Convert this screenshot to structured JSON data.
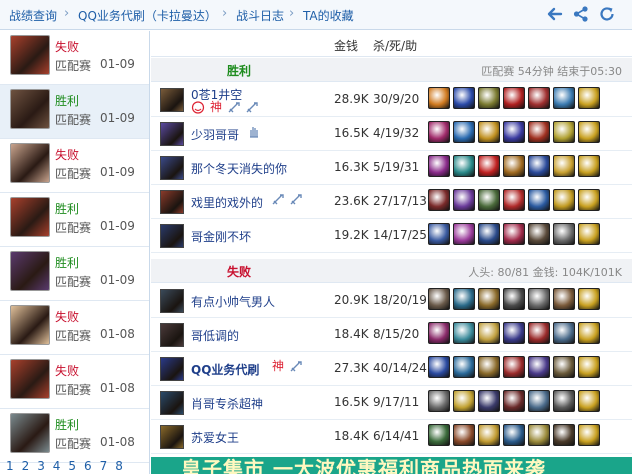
{
  "breadcrumbs": [
    {
      "label": "战绩查询",
      "icon": ""
    },
    {
      "label": "QQ业务代刷（卡拉曼达）",
      "icon": ""
    },
    {
      "label": "战斗日志",
      "icon": ""
    },
    {
      "label": "TA的收藏",
      "icon": ""
    }
  ],
  "toolbar": {
    "back_icon": "back-arrow-icon",
    "share_icon": "share-icon",
    "refresh_icon": "refresh-icon"
  },
  "sidebar": {
    "items": [
      {
        "result": "失败",
        "mode": "匹配赛",
        "date": "01-09",
        "win": false,
        "avatar_color": "#a8402c",
        "active": false
      },
      {
        "result": "胜利",
        "mode": "匹配赛",
        "date": "01-09",
        "win": true,
        "avatar_color": "#6e5240",
        "active": true
      },
      {
        "result": "失败",
        "mode": "匹配赛",
        "date": "01-09",
        "win": false,
        "avatar_color": "#c9a48e",
        "active": false
      },
      {
        "result": "胜利",
        "mode": "匹配赛",
        "date": "01-09",
        "win": true,
        "avatar_color": "#a8402c",
        "active": false
      },
      {
        "result": "胜利",
        "mode": "匹配赛",
        "date": "01-09",
        "win": true,
        "avatar_color": "#5a3a6e",
        "active": false
      },
      {
        "result": "失败",
        "mode": "匹配赛",
        "date": "01-08",
        "win": false,
        "avatar_color": "#e0c09a",
        "active": false
      },
      {
        "result": "失败",
        "mode": "匹配赛",
        "date": "01-08",
        "win": false,
        "avatar_color": "#a8402c",
        "active": false
      },
      {
        "result": "胜利",
        "mode": "匹配赛",
        "date": "01-08",
        "win": true,
        "avatar_color": "#7a8a8e",
        "active": false
      }
    ],
    "pages": [
      "1",
      "2",
      "3",
      "4",
      "5",
      "6",
      "7",
      "8"
    ]
  },
  "columns": {
    "gold": "金钱",
    "kda": "杀/死/助"
  },
  "win_section": {
    "title": "胜利",
    "info": "匹配赛 54分钟 结束于05:30"
  },
  "lose_section": {
    "title": "失败",
    "info": "人头: 80/81 金钱: 104K/101K"
  },
  "win_players": [
    {
      "name": "0苍1井空",
      "gold": "28.9K",
      "kda": "30/9/20",
      "champ_color": "#7a5c3a",
      "badges": [
        "face-icon",
        "神",
        "sword-icon",
        "sword-icon"
      ],
      "items": [
        "#d07a20",
        "#2a4aa8",
        "#7a7a30",
        "#b02020",
        "#a03030",
        "#3a7ab0",
        "#c8a020"
      ]
    },
    {
      "name": "少羽哥哥",
      "gold": "16.5K",
      "kda": "4/19/32",
      "champ_color": "#5a4aa0",
      "badges": [
        "hand-icon"
      ],
      "items": [
        "#a02a6a",
        "#2a6ab0",
        "#c09020",
        "#3a3aa0",
        "#a03020",
        "#b0a030",
        "#c8a020"
      ]
    },
    {
      "name": "那个冬天消失的你",
      "gold": "16.3K",
      "kda": "5/19/31",
      "champ_color": "#3a4a8a",
      "badges": [],
      "items": [
        "#8a2a8a",
        "#2a8a8a",
        "#c02020",
        "#a06a20",
        "#2a4a9a",
        "#c8a030",
        "#c8a020"
      ]
    },
    {
      "name": "戏里的戏外的",
      "gold": "23.6K",
      "kda": "27/17/13",
      "champ_color": "#8a3a2a",
      "badges": [
        "sword-icon",
        "sword-icon"
      ],
      "items": [
        "#7a2a2a",
        "#6a3a9a",
        "#4a6a3a",
        "#b02a2a",
        "#2a5aa0",
        "#c09a20",
        "#c8a020"
      ]
    },
    {
      "name": "哥金刚不坏",
      "gold": "19.2K",
      "kda": "14/17/25",
      "champ_color": "#2a3a6a",
      "badges": [],
      "items": [
        "#3a5aa0",
        "#9a3a9a",
        "#2a4a8a",
        "#a02a4a",
        "#5a4a3a",
        "#6a6a6a",
        "#c8a020"
      ]
    }
  ],
  "lose_players": [
    {
      "name": "有点小帅气男人",
      "gold": "20.9K",
      "kda": "18/20/19",
      "champ_color": "#3a4a5a",
      "badges": [],
      "items": [
        "#6a5a4a",
        "#2a6a8a",
        "#8a6a2a",
        "#4a4a4a",
        "#6a6a6a",
        "#7a5a3a",
        "#c8a020"
      ]
    },
    {
      "name": "哥低调的",
      "gold": "18.4K",
      "kda": "8/15/20",
      "champ_color": "#4a3a3a",
      "badges": [],
      "items": [
        "#8a2a6a",
        "#3a8a9a",
        "#c0a040",
        "#3a3a8a",
        "#9a2a2a",
        "#4a6a8a",
        "#c8a020"
      ]
    },
    {
      "name": "QQ业务代刷",
      "gold": "27.3K",
      "kda": "40/14/24",
      "champ_color": "#2a3a8a",
      "badges": [
        "神",
        "sword-icon"
      ],
      "items": [
        "#2a4aa0",
        "#2a6a9a",
        "#8a6a2a",
        "#9a2a2a",
        "#4a3a8a",
        "#6a5a3a",
        "#c8a020"
      ]
    },
    {
      "name": "肖哥专杀超神",
      "gold": "16.5K",
      "kda": "9/17/11",
      "champ_color": "#2a4a6a",
      "badges": [],
      "items": [
        "#6a6a6a",
        "#c0a030",
        "#3a3a6a",
        "#6a2a2a",
        "#4a6a8a",
        "#5a5a5a",
        "#c8a020"
      ]
    },
    {
      "name": "苏爱女王",
      "gold": "18.4K",
      "kda": "6/14/41",
      "champ_color": "#8a6a2a",
      "badges": [],
      "items": [
        "#3a6a3a",
        "#8a4a2a",
        "#c09a30",
        "#2a5a8a",
        "#9a8a3a",
        "#4a3a2a",
        "#c8a020"
      ]
    }
  ],
  "banner": {
    "text": "皇子集市 一大波优惠福利商品热面来袭"
  }
}
